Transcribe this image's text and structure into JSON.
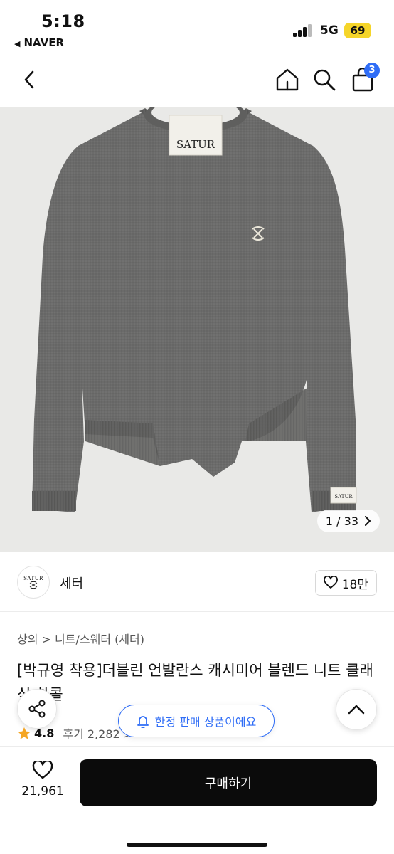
{
  "status": {
    "time": "5:18",
    "back_app": "NAVER",
    "network": "5G",
    "battery": "69"
  },
  "nav": {
    "cart_count": "3"
  },
  "product": {
    "label_brand": "SATUR",
    "pager": "1 / 33",
    "shop_name": "세터",
    "shop_logo_text": "SATUR",
    "likes": "18만",
    "breadcrumb": "상의 > 니트/스웨터 (세터)",
    "title": "[박규영 착용]더블린 언발란스 캐시미어 블렌드 니트 클래식 차콜",
    "rating_score": "4.8",
    "reviews": "후기 2,282 >"
  },
  "floating": {
    "toast": "한정 판매 상품이에요"
  },
  "bottom": {
    "wish_count": "21,961",
    "buy_label": "구매하기"
  },
  "colors": {
    "accent": "#2f6df6",
    "sweater": "#6b6b6a",
    "buy_button": "#0b0b0b",
    "star": "#f5a623"
  }
}
